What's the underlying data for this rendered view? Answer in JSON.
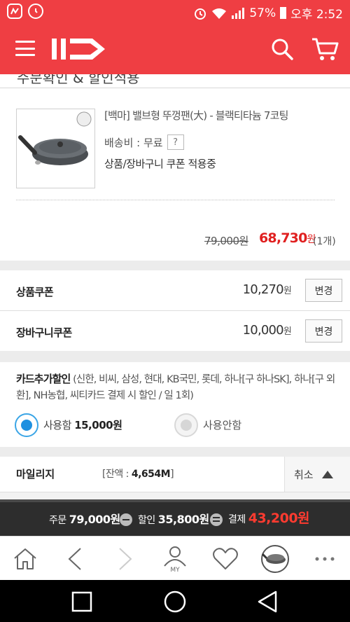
{
  "status_bar": {
    "battery": "57%",
    "time": "오후 2:52"
  },
  "header": {
    "logo": "11번가",
    "colors": {
      "brand": "#ef3e43"
    }
  },
  "section_title": "주문확인 & 할인적용",
  "product": {
    "name": "[백마] 밸브형 뚜껑팬(大) - 블랙티타늄 7코팅",
    "shipping_label": "배송비 : 무료",
    "help": "?",
    "coupon_note": "상품/장바구니 쿠폰 적용중",
    "original_price": "79,000원",
    "sale_price": "68,730",
    "sale_unit": "원",
    "quantity": "(1개)"
  },
  "coupons": [
    {
      "label": "상품쿠폰",
      "amount": "10,270",
      "unit": "원",
      "button": "변경"
    },
    {
      "label": "장바구니쿠폰",
      "amount": "10,000",
      "unit": "원",
      "button": "변경"
    }
  ],
  "card_discount": {
    "title": "카드추가할인",
    "detail": "(신한, 비씨, 삼성, 현대, KB국민, 롯데, 하나[구 하나SK], 하나[구 외환], NH농협, 씨티카드 결제 시 할인 / 일 1회)",
    "option_use": "사용함",
    "option_use_amount": "15,000원",
    "option_none": "사용안함",
    "selected": "사용함"
  },
  "mileage": {
    "label": "마일리지",
    "balance_prefix": "[잔액 : ",
    "balance_value": "4,654M",
    "balance_suffix": "]",
    "cancel": "취소"
  },
  "summary": {
    "order_label": "주문",
    "order_value": "79,000원",
    "discount_label": "할인",
    "discount_value": "35,800원",
    "pay_label": "결제",
    "pay_value": "43,200원"
  },
  "bottom_nav": {
    "items": [
      "home-icon",
      "back-icon",
      "forward-icon",
      "my-icon",
      "wishlist-heart-icon",
      "recent-product-thumb",
      "more-icon"
    ],
    "my_label": "MY"
  }
}
